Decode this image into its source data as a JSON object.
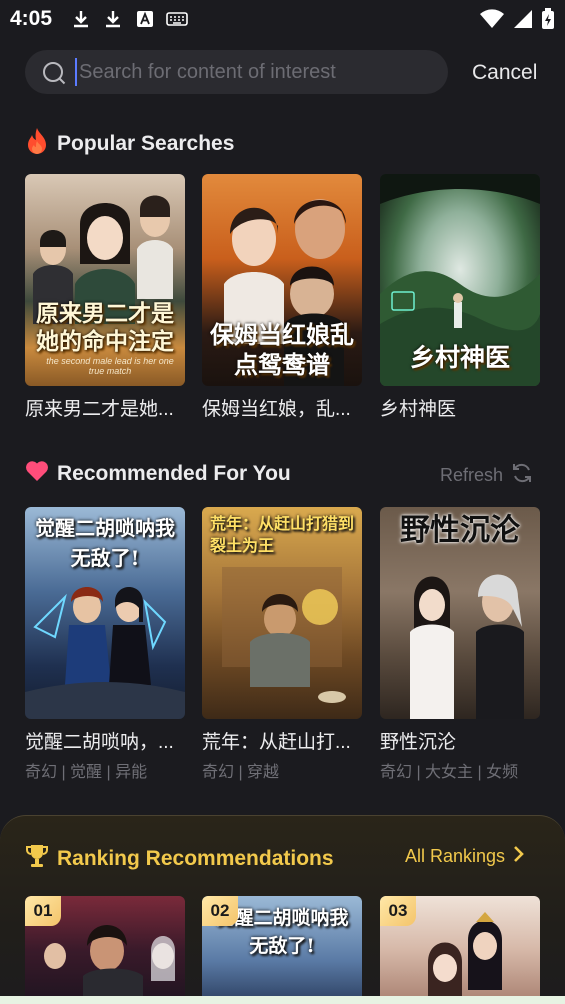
{
  "status_bar": {
    "time": "4:05"
  },
  "search": {
    "placeholder": "Search for content of interest",
    "cancel_label": "Cancel"
  },
  "popular": {
    "title": "Popular Searches",
    "items": [
      {
        "title": "原来男二才是她...",
        "poster_text": "原来男二才是她的命中注定",
        "poster_subtext": "the second male lead is her one true match"
      },
      {
        "title": "保姆当红娘，乱...",
        "poster_text": "保姆当红娘乱点鸳鸯谱"
      },
      {
        "title": "乡村神医",
        "poster_text": "乡村神医"
      }
    ]
  },
  "recommended": {
    "title": "Recommended For You",
    "refresh_label": "Refresh",
    "items": [
      {
        "title": "觉醒二胡唢呐，...",
        "tags": "奇幻 | 觉醒 | 异能",
        "poster_text": "觉醒二胡唢呐我无敌了!"
      },
      {
        "title": "荒年：从赶山打...",
        "tags": "奇幻 | 穿越",
        "poster_text": "荒年：从赶山打猎到裂土为王"
      },
      {
        "title": "野性沉沦",
        "tags": "奇幻 | 大女主 | 女频",
        "poster_text": "野性沉沦"
      }
    ]
  },
  "ranking": {
    "title": "Ranking Recommendations",
    "all_label": "All Rankings",
    "items": [
      {
        "rank": "01"
      },
      {
        "rank": "02",
        "poster_text": "觉醒二胡唢呐我无敌了!"
      },
      {
        "rank": "03"
      }
    ]
  },
  "colors": {
    "background": "#1b1b1f",
    "accent_gold": "#f2c94c",
    "fire": "#ff4d2e",
    "heart": "#ff4d7a"
  }
}
